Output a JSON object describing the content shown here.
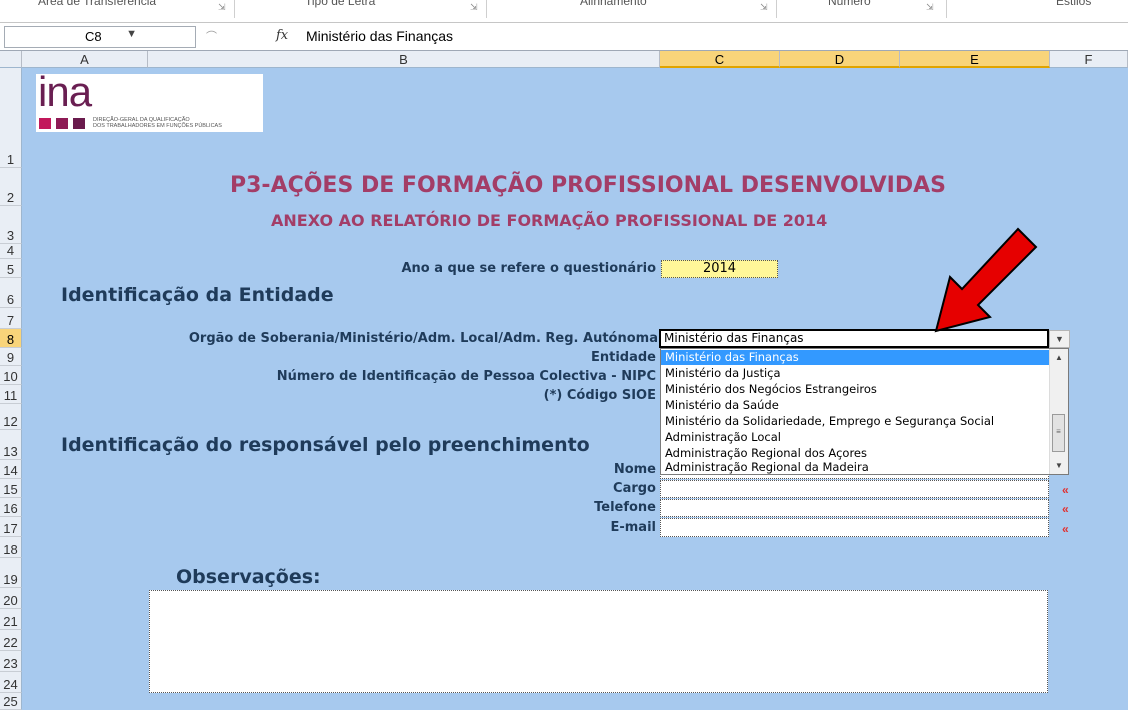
{
  "ribbon": {
    "groups": [
      "Área de Transferência",
      "Tipo de Letra",
      "Alinhamento",
      "Número",
      "Estilos"
    ]
  },
  "formula_bar": {
    "name_box": "C8",
    "fx": "fx",
    "value": "Ministério das Finanças"
  },
  "columns": [
    "A",
    "B",
    "C",
    "D",
    "E",
    "F"
  ],
  "rows": [
    "1",
    "2",
    "3",
    "4",
    "5",
    "6",
    "7",
    "8",
    "9",
    "10",
    "11",
    "12",
    "13",
    "14",
    "15",
    "16",
    "17",
    "18",
    "19",
    "20",
    "21",
    "22",
    "23",
    "24",
    "25"
  ],
  "logo": {
    "text": "ina",
    "line1": "DIREÇÃO-GERAL DA QUALIFICAÇÃO",
    "line2": "DOS TRABALHADORES EM FUNÇÕES PÚBLICAS",
    "colors": [
      "#c2185b",
      "#8e1b55",
      "#6a1b4d"
    ]
  },
  "form": {
    "title": "P3-AÇÕES DE FORMAÇÃO PROFISSIONAL DESENVOLVIDAS",
    "subtitle": "ANEXO AO RELATÓRIO DE FORMAÇÃO PROFISSIONAL DE 2014",
    "year_label": "Ano a que se refere o questionário",
    "year_value": "2014",
    "section1": "Identificação da Entidade",
    "orgao_label": "Orgão de Soberania/Ministério/Adm. Local/Adm. Reg. Autónoma",
    "orgao_value": "Ministério das Finanças",
    "entidade_label": "Entidade",
    "nipc_label": "Número de Identificação de Pessoa Colectiva - NIPC",
    "sioe_label": "(*) Código SIOE",
    "section2": "Identificação do responsável pelo preenchimento",
    "nome_label": "Nome",
    "cargo_label": "Cargo",
    "telefone_label": "Telefone",
    "email_label": "E-mail",
    "required_marker": "«",
    "obs_label": "Observações:"
  },
  "dropdown_options": [
    "Ministério das Finanças",
    "Ministério da Justiça",
    "Ministério dos Negócios Estrangeiros",
    "Ministério da Saúde",
    "Ministério da Solidariedade, Emprego e Segurança Social",
    "Administração Local",
    "Administração Regional dos Açores",
    "Administração Regional da Madeira"
  ],
  "colors": {
    "sheet_bg": "#a7c9ee",
    "title": "#a33d67",
    "label": "#1f3b5a",
    "highlight": "#3399ff",
    "arrow": "#e60000"
  }
}
